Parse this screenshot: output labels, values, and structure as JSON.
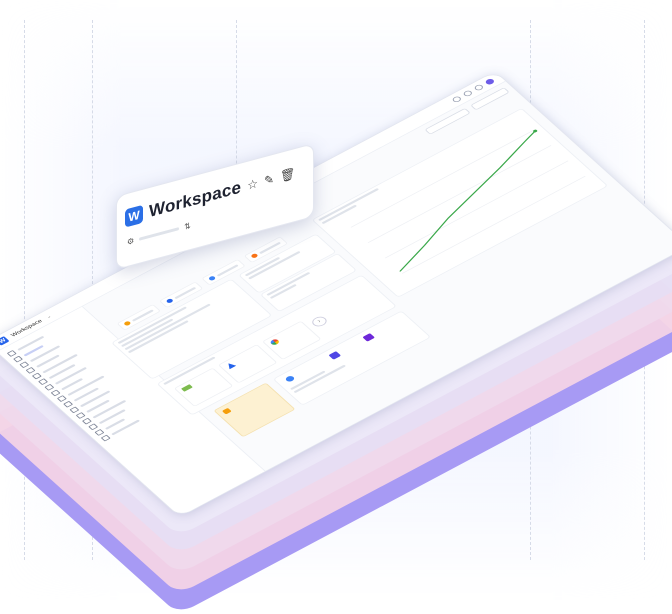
{
  "window": {
    "app_title": "Workspace",
    "logo_letter": "W",
    "sidebar_items": [
      "",
      "",
      "",
      "",
      "",
      "",
      "",
      "",
      "",
      "",
      "",
      "",
      "",
      "",
      "",
      ""
    ]
  },
  "workspace_card": {
    "logo_letter": "W",
    "title": "Workspace",
    "star_icon": "star-icon",
    "edit_icon": "edit-icon",
    "delete_icon": "trash-icon",
    "flow_icon": "flow-icon",
    "settings_icon": "gear-icon"
  },
  "colors": {
    "accent_blue": "#2563eb",
    "accent_purple": "#6d5ce8",
    "chart_line": "#3aa84a",
    "layer_purple": "#a79af4",
    "layer_pink": "#f3d3e6"
  }
}
